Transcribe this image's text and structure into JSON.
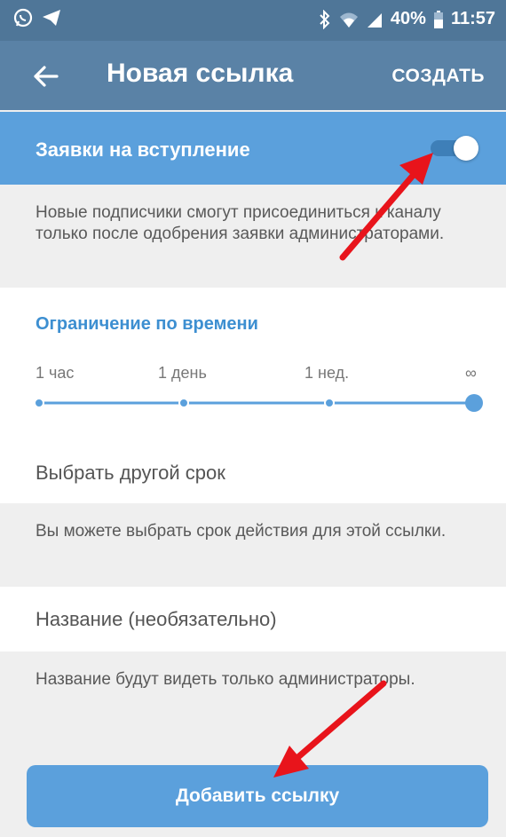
{
  "status_bar": {
    "battery": "40%",
    "time": "11:57"
  },
  "app_bar": {
    "title": "Новая ссылка",
    "create_label": "СОЗДАТЬ"
  },
  "join_requests": {
    "label": "Заявки на вступление",
    "enabled": true,
    "description": "Новые подписчики смогут присоединиться к каналу только после одобрения заявки администраторами."
  },
  "time_limit": {
    "title": "Ограничение по времени",
    "ticks": [
      "1 час",
      "1 день",
      "1 нед.",
      "∞"
    ],
    "selected": "∞",
    "custom_label": "Выбрать другой срок",
    "description": "Вы можете выбрать срок действия для этой ссылки."
  },
  "name_field": {
    "placeholder": "Название (необязательно)",
    "description": "Название будут видеть только администраторы."
  },
  "add_button": {
    "label": "Добавить ссылку"
  },
  "colors": {
    "accent": "#5ba0dc",
    "header": "#5a82a6",
    "annotation_arrow": "#e8141b"
  }
}
